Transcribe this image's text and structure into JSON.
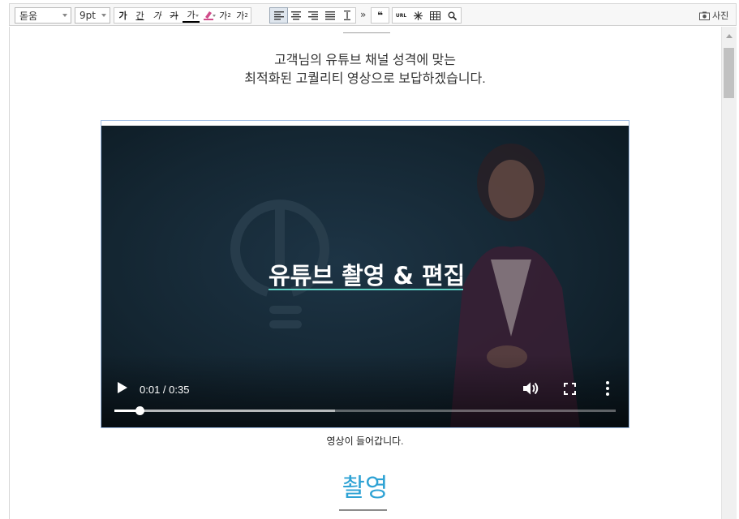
{
  "toolbar": {
    "font_family": "돋움",
    "font_size": "9pt",
    "format_buttons": [
      "가",
      "간",
      "가",
      "가",
      "가",
      "가",
      "가",
      "가"
    ],
    "more_label": "»",
    "quote_label": "❝",
    "url_label": "URL",
    "photo_label": "사진"
  },
  "content": {
    "intro_line1": "고객님의 유튜브 채널 성격에 맞는",
    "intro_line2": "최적화된 고퀄리티 영상으로 보답하겠습니다.",
    "video": {
      "overlay_title": "유튜브 촬영 & 편집",
      "time_display": "0:01 / 0:35",
      "progress_fraction": 0.05,
      "buffered_fraction": 0.44
    },
    "caption": "영상이 들어갑니다.",
    "section_title": "촬영"
  },
  "colors": {
    "section_title": "#2ea2d4",
    "title_underline": "#5fd0c4",
    "video_bg": "#142632"
  }
}
